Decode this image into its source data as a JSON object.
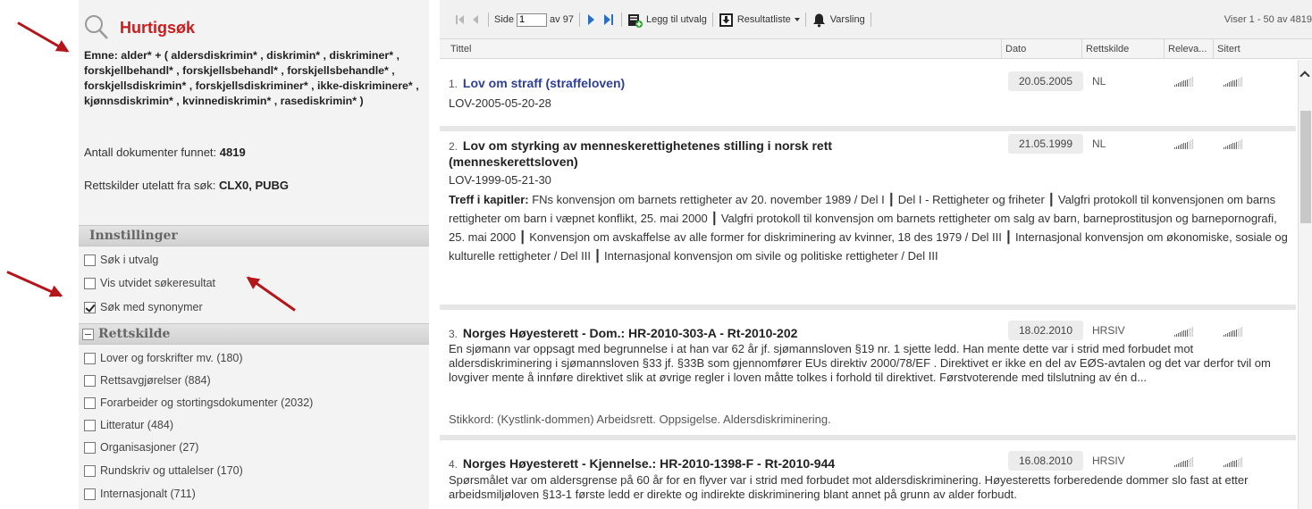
{
  "search": {
    "title": "Hurtigsøk",
    "emne": "Emne: alder* + ( aldersdiskrimin* , diskrimin* , diskriminer* , forskjellbehandl* , forskjellsbehandl* , forskjellsbehandle* , forskjellsdiskrimin* , forskjellsdiskriminer* , ikke-diskriminere* , kjønnsdiskrimin* , kvinnediskrimin* , rasediskrimin* )",
    "antall_label": "Antall dokumenter funnet:",
    "antall_value": "4819",
    "utelatt_label": "Rettskilder utelatt fra søk:",
    "utelatt_value": "CLX0, PUBG"
  },
  "innstillinger": {
    "heading": "Innstillinger",
    "options": [
      {
        "label": "Søk i utvalg",
        "checked": false
      },
      {
        "label": "Vis utvidet søkeresultat",
        "checked": false
      },
      {
        "label": "Søk med synonymer",
        "checked": true
      }
    ]
  },
  "rettskilde": {
    "heading": "Rettskilde",
    "options": [
      {
        "label": "Lover og forskrifter mv. (180)"
      },
      {
        "label": "Rettsavgjørelser (884)"
      },
      {
        "label": "Forarbeider og stortingsdokumenter (2032)"
      },
      {
        "label": "Litteratur (484)"
      },
      {
        "label": "Organisasjoner (27)"
      },
      {
        "label": "Rundskriv og uttalelser (170)"
      },
      {
        "label": "Internasjonalt (711)"
      }
    ]
  },
  "toolbar": {
    "side_label": "Side",
    "page_value": "1",
    "av_label": "av 97",
    "legg_til": "Legg til utvalg",
    "resultatliste": "Resultatliste",
    "varsling": "Varsling",
    "viser": "Viser 1 - 50 av 4819"
  },
  "columns": {
    "tittel": "Tittel",
    "dato": "Dato",
    "rettskilde": "Rettskilde",
    "releva": "Releva...",
    "sitert": "Sitert"
  },
  "results": [
    {
      "num": "1.",
      "title": "Lov om straff (straffeloven)",
      "sub": "LOV-2005-05-20-28",
      "date": "20.05.2005",
      "source": "NL"
    },
    {
      "num": "2.",
      "title": "Lov om styrking av menneskerettighetenes stilling i norsk rett (menneskerettsloven)",
      "sub": "LOV-1999-05-21-30",
      "date": "21.05.1999",
      "source": "NL",
      "kap_label": "Treff i kapitler:",
      "kapitler": "FNs konvensjon om barnets rettigheter av 20. november 1989 / Del I ┃ Del I - Rettigheter og friheter ┃ Valgfri protokoll til konvensjonen om barns rettigheter om barn i væpnet konflikt, 25. mai 2000 ┃ Valgfri protokoll til konvensjon om barnets rettigheter om salg av barn, barneprostitusjon og barnepornografi, 25. mai 2000 ┃ Konvensjon om avskaffelse av alle former for diskriminering av kvinner, 18 des 1979 / Del III ┃ Internasjonal konvensjon om økonomiske, sosiale og kulturelle rettigheter / Del III ┃ Internasjonal konvensjon om sivile og politiske rettigheter / Del III"
    },
    {
      "num": "3.",
      "title": "Norges Høyesterett - Dom.: HR-2010-303-A - Rt-2010-202",
      "date": "18.02.2010",
      "source": "HRSIV",
      "body": "En sjømann var oppsagt med begrunnelse i at han var 62 år jf. sjømannsloven §19 nr. 1 sjette ledd. Han mente dette var i strid med forbudet mot aldersdiskriminering i sjømannsloven §33 jf. §33B som gjennomfører EUs direktiv 2000/78/EF . Direktivet er ikke en del av EØS-avtalen og det var derfor tvil om lovgiver mente å innføre direktivet slik at øvrige regler i loven måtte tolkes i forhold til direktivet. Førstvoterende med tilslutning av én d...",
      "stikkord": "Stikkord: (Kystlink-dommen) Arbeidsrett. Oppsigelse. Aldersdiskriminering."
    },
    {
      "num": "4.",
      "title": "Norges Høyesterett - Kjennelse.: HR-2010-1398-F - Rt-2010-944",
      "date": "16.08.2010",
      "source": "HRSIV",
      "body": "Spørsmålet var om aldersgrense på 60 år for en flyver var i strid med forbudet mot aldersdiskriminering. Høyesteretts forberedende dommer slo fast at etter arbeidsmiljøloven §13-1 første ledd er direkte og indirekte diskriminering blant annet på grunn av alder forbudt."
    }
  ],
  "colors": {
    "accent_red": "#cc1b1b",
    "link_blue": "#2c3f9a",
    "nav_blue": "#2b6fc0",
    "arrow_red": "#b3151b"
  },
  "icons": [
    "search-icon",
    "first-page-icon",
    "prev-page-icon",
    "next-page-icon",
    "last-page-icon",
    "add-selection-icon",
    "download-icon",
    "bell-icon",
    "caret-down-icon",
    "scroll-up-icon",
    "collapse-icon",
    "relevance-bars-icon"
  ]
}
